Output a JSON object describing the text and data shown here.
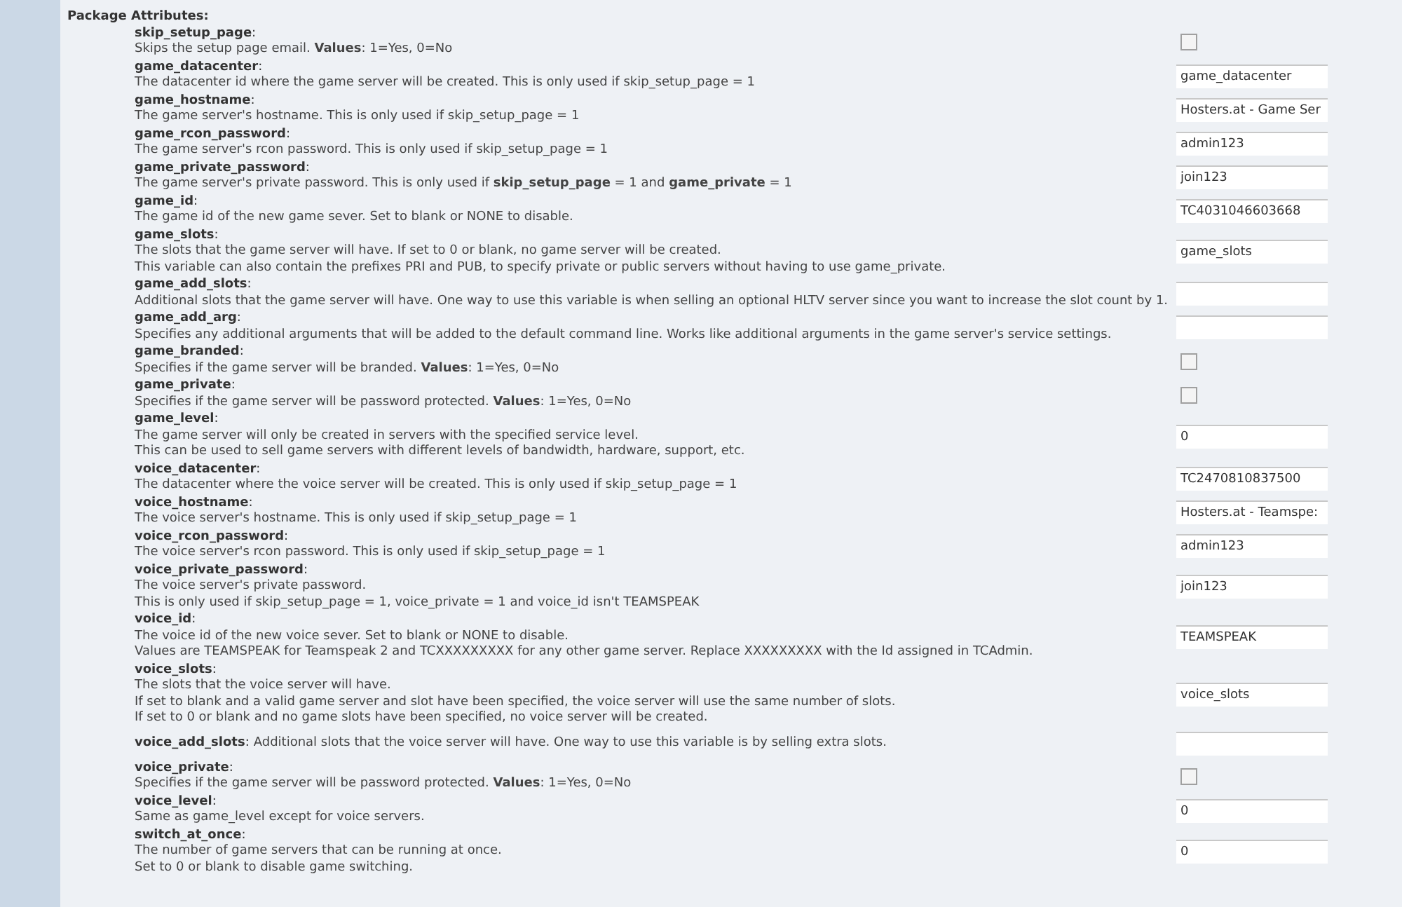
{
  "section_title": "Package Attributes:",
  "attributes": [
    {
      "name": "**skip_setup_page**:",
      "lines": [
        "Skips the setup page email. **Values**: 1=Yes, 0=No"
      ],
      "field": {
        "kind": "checkbox",
        "checked": false
      }
    },
    {
      "name": "**game_datacenter**:",
      "lines": [
        "The datacenter id where the game server will be created. This is only used if skip_setup_page = 1"
      ],
      "field": {
        "kind": "text",
        "value": "game_datacenter"
      }
    },
    {
      "name": "**game_hostname**:",
      "lines": [
        "The game server's hostname. This is only used if skip_setup_page = 1"
      ],
      "field": {
        "kind": "text",
        "value": "Hosters.at - Game Ser"
      }
    },
    {
      "name": "**game_rcon_password**:",
      "lines": [
        "The game server's rcon password. This is only used if skip_setup_page = 1"
      ],
      "field": {
        "kind": "text",
        "value": "admin123"
      }
    },
    {
      "name": "**game_private_password**:",
      "lines": [
        "The game server's private password. This is only used if **skip_setup_page** = 1 and **game_private** = 1"
      ],
      "field": {
        "kind": "text",
        "value": "join123"
      }
    },
    {
      "name": "**game_id**:",
      "lines": [
        "The game id of the new game sever. Set to blank or NONE to disable."
      ],
      "field": {
        "kind": "text",
        "value": "TC4031046603668"
      }
    },
    {
      "name": "**game_slots**:",
      "lines": [
        "The slots that the game server will have. If set to 0 or blank, no game server will be created.",
        "This variable can also contain the prefixes PRI and PUB, to specify private or public servers without having to use game_private."
      ],
      "field": {
        "kind": "text",
        "value": "game_slots"
      }
    },
    {
      "name": "**game_add_slots**:",
      "lines": [
        "Additional slots that the game server will have. One way to use this variable is when selling an optional HLTV server since you want to increase the slot count by 1."
      ],
      "field": {
        "kind": "text"
      }
    },
    {
      "name": "**game_add_arg**:",
      "lines": [
        "Specifies any additional arguments that will be added to the default command line. Works like additional arguments in the game server's service settings."
      ],
      "field": {
        "kind": "text"
      }
    },
    {
      "name": "**game_branded**:",
      "lines": [
        "Specifies if the game server will be branded. **Values**: 1=Yes, 0=No"
      ],
      "field": {
        "kind": "checkbox",
        "checked": false
      }
    },
    {
      "name": "**game_private**:",
      "lines": [
        "Specifies if the game server will be password protected. **Values**: 1=Yes, 0=No"
      ],
      "field": {
        "kind": "checkbox",
        "checked": false
      }
    },
    {
      "name": "**game_level**:",
      "lines": [
        "The game server will only be created in servers with the specified service level.",
        "This can be used to sell game servers with different levels of bandwidth, hardware, support, etc."
      ],
      "field": {
        "kind": "text",
        "value": "0"
      }
    },
    {
      "name": "**voice_datacenter**:",
      "lines": [
        "The datacenter where the voice server will be created. This is only used if skip_setup_page = 1"
      ],
      "field": {
        "kind": "text",
        "value": "TC2470810837500"
      }
    },
    {
      "name": "**voice_hostname**:",
      "lines": [
        "The voice server's hostname. This is only used if skip_setup_page = 1"
      ],
      "field": {
        "kind": "text",
        "value": "Hosters.at - Teamspe:"
      }
    },
    {
      "name": "**voice_rcon_password**:",
      "lines": [
        "The voice server's rcon password. This is only used if skip_setup_page = 1"
      ],
      "field": {
        "kind": "text",
        "value": "admin123"
      }
    },
    {
      "name": "**voice_private_password**:",
      "lines": [
        "The voice server's private password.",
        "This is only used if skip_setup_page = 1, voice_private = 1 and voice_id isn't TEAMSPEAK"
      ],
      "field": {
        "kind": "text",
        "value": "join123"
      }
    },
    {
      "name": "**voice_id**:",
      "lines": [
        "The voice id of the new voice sever. Set to blank or NONE to disable.",
        "Values are TEAMSPEAK for Teamspeak 2 and TCXXXXXXXXX for any other game server. Replace XXXXXXXXX with the Id assigned in TCAdmin."
      ],
      "field": {
        "kind": "text",
        "value": "TEAMSPEAK"
      }
    },
    {
      "name": "**voice_slots**:",
      "lines": [
        "The slots that the voice server will have.",
        "If set to blank and a valid game server and slot have been specified, the voice server will use the same number of slots.",
        "If set to 0 or blank and no game slots have been specified, no voice server will be created."
      ],
      "field": {
        "kind": "text",
        "value": "voice_slots"
      }
    },
    {
      "name": "**voice_add_slots**:",
      "inline": true,
      "lines": [
        "Additional slots that the voice server will have. One way to use this variable is by selling extra slots."
      ],
      "field": {
        "kind": "text"
      }
    },
    {
      "name": "**voice_private**:",
      "lines": [
        "Specifies if the game server will be password protected. **Values**: 1=Yes, 0=No"
      ],
      "field": {
        "kind": "checkbox",
        "checked": false
      }
    },
    {
      "name": "**voice_level**:",
      "lines": [
        "Same as game_level except for voice servers."
      ],
      "field": {
        "kind": "text",
        "value": "0"
      }
    },
    {
      "name": "**switch_at_once**:",
      "lines": [
        "The number of game servers that can be running at once.",
        "Set to 0 or blank to disable game switching."
      ],
      "field": {
        "kind": "text",
        "value": "0"
      }
    }
  ]
}
